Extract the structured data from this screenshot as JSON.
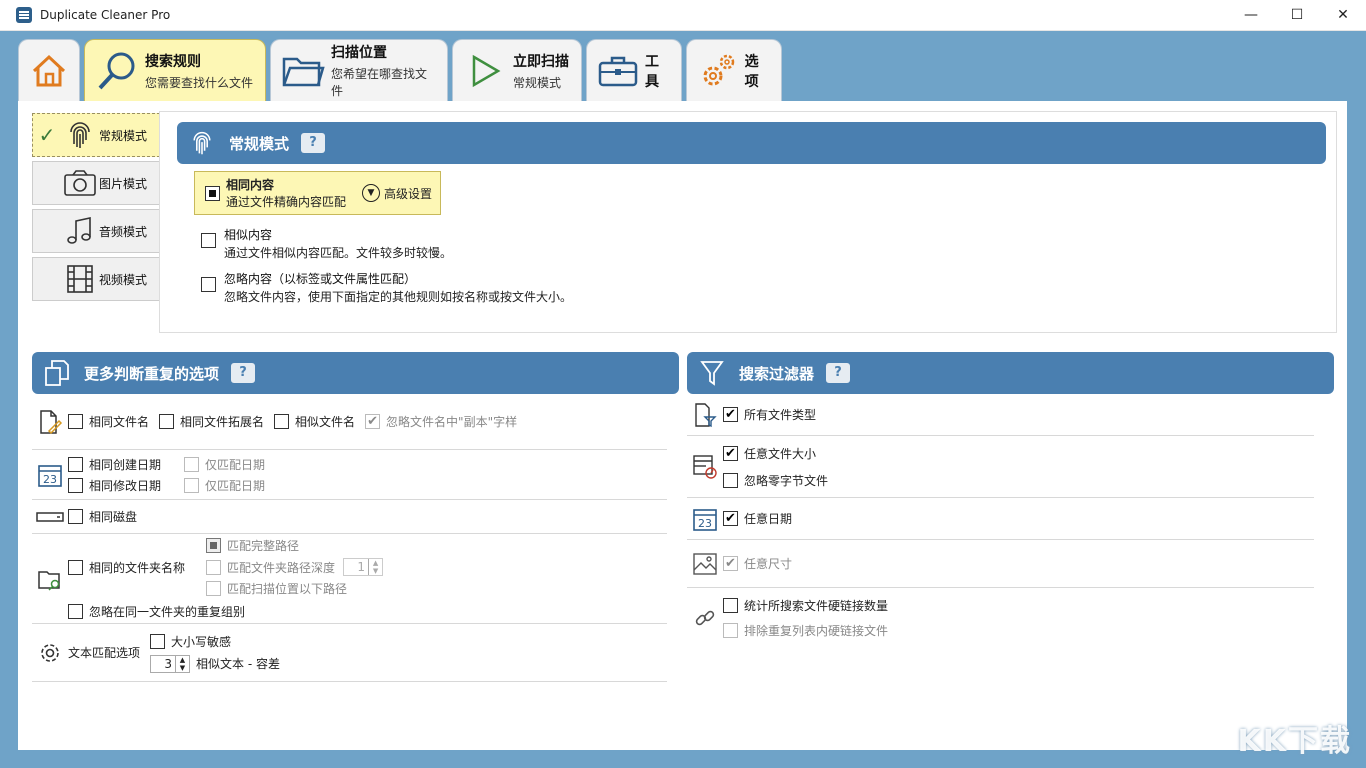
{
  "window": {
    "title": "Duplicate Cleaner Pro"
  },
  "tabs": [
    {
      "id": "home",
      "main": "",
      "sub": ""
    },
    {
      "id": "search-rules",
      "main": "搜索规则",
      "sub": "您需要查找什么文件"
    },
    {
      "id": "scan-location",
      "main": "扫描位置",
      "sub": "您希望在哪查找文件"
    },
    {
      "id": "scan-now",
      "main": "立即扫描",
      "sub": "常规模式"
    },
    {
      "id": "tools",
      "main": "工具",
      "sub": ""
    },
    {
      "id": "options",
      "main": "选项",
      "sub": ""
    }
  ],
  "modes": [
    {
      "label": "常规模式",
      "icon": "fingerprint-icon"
    },
    {
      "label": "图片模式",
      "icon": "camera-icon"
    },
    {
      "label": "音频模式",
      "icon": "music-note-icon"
    },
    {
      "label": "视频模式",
      "icon": "film-icon"
    }
  ],
  "mode_panel": {
    "title": "常规模式",
    "help": "?",
    "same_content": {
      "title": "相同内容",
      "desc": "通过文件精确内容匹配"
    },
    "advanced": "高级设置",
    "similar_content": {
      "title": "相似内容",
      "desc": "通过文件相似内容匹配。文件较多时较慢。"
    },
    "ignore_content": {
      "title": "忽略内容（以标签或文件属性匹配）",
      "desc": "忽略文件内容，使用下面指定的其他规则如按名称或按文件大小。"
    }
  },
  "more_options": {
    "title": "更多判断重复的选项",
    "help": "?",
    "same_filename": "相同文件名",
    "same_ext": "相同文件拓展名",
    "similar_filename": "相似文件名",
    "ignore_copy": "忽略文件名中\"副本\"字样",
    "same_created": "相同创建日期",
    "created_date_only": "仅匹配日期",
    "same_modified": "相同修改日期",
    "modified_date_only": "仅匹配日期",
    "same_disk": "相同磁盘",
    "same_folder_name": "相同的文件夹名称",
    "match_full_path": "匹配完整路径",
    "match_depth": "匹配文件夹路径深度",
    "depth_value": "1",
    "match_below_scan": "匹配扫描位置以下路径",
    "ignore_same_folder": "忽略在同一文件夹的重复组别",
    "text_match": "文本匹配选项",
    "case_sensitive": "大小写敏感",
    "tolerance_value": "3",
    "tolerance_label": "相似文本 - 容差"
  },
  "filters": {
    "title": "搜索过滤器",
    "help": "?",
    "all_types": "所有文件类型",
    "any_size": "任意文件大小",
    "ignore_zero": "忽略零字节文件",
    "any_date": "任意日期",
    "any_dimension": "任意尺寸",
    "count_hardlinks": "统计所搜索文件硬链接数量",
    "exclude_hardlinks": "排除重复列表内硬链接文件"
  },
  "watermark": "KK下载",
  "colors": {
    "header": "#4a7fb0",
    "active_tab": "#fdf7b5",
    "frame": "#6fa3c8"
  }
}
